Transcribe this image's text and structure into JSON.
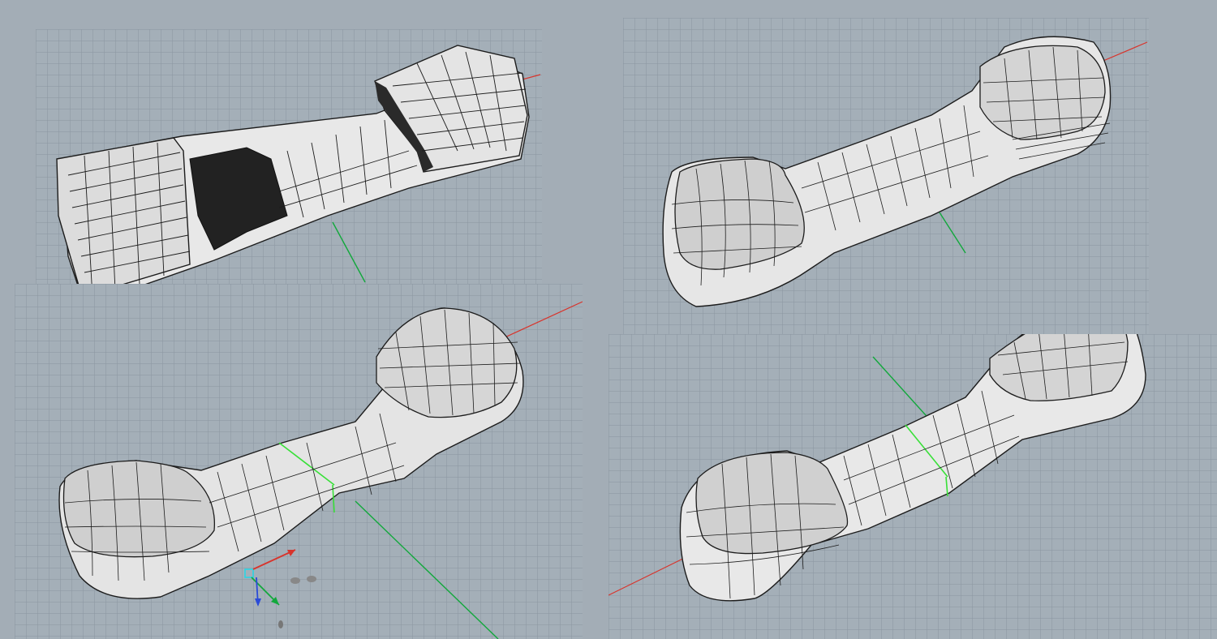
{
  "viewports": [
    {
      "name": "top-left",
      "model_stage": "base-box-with-recesses"
    },
    {
      "name": "top-right",
      "model_stage": "rounded-handset"
    },
    {
      "name": "bottom-left",
      "model_stage": "editing-with-gizmo"
    },
    {
      "name": "bottom-right",
      "model_stage": "final-handset"
    }
  ],
  "colors": {
    "background": "#a3adb6",
    "grid": "#8c98a2",
    "surface": "#e6e6e6",
    "surface_shadow": "#b9bcbf",
    "isocurve": "#1c1c1c",
    "axis_x": "#d8342c",
    "axis_y": "#12a83c",
    "axis_z": "#2a4bd8",
    "selection": "#38e038",
    "recess": "#222222"
  },
  "icons": [
    "x-axis-arrow-icon",
    "y-axis-arrow-icon",
    "z-axis-arrow-icon",
    "gumball-handle-icon"
  ]
}
